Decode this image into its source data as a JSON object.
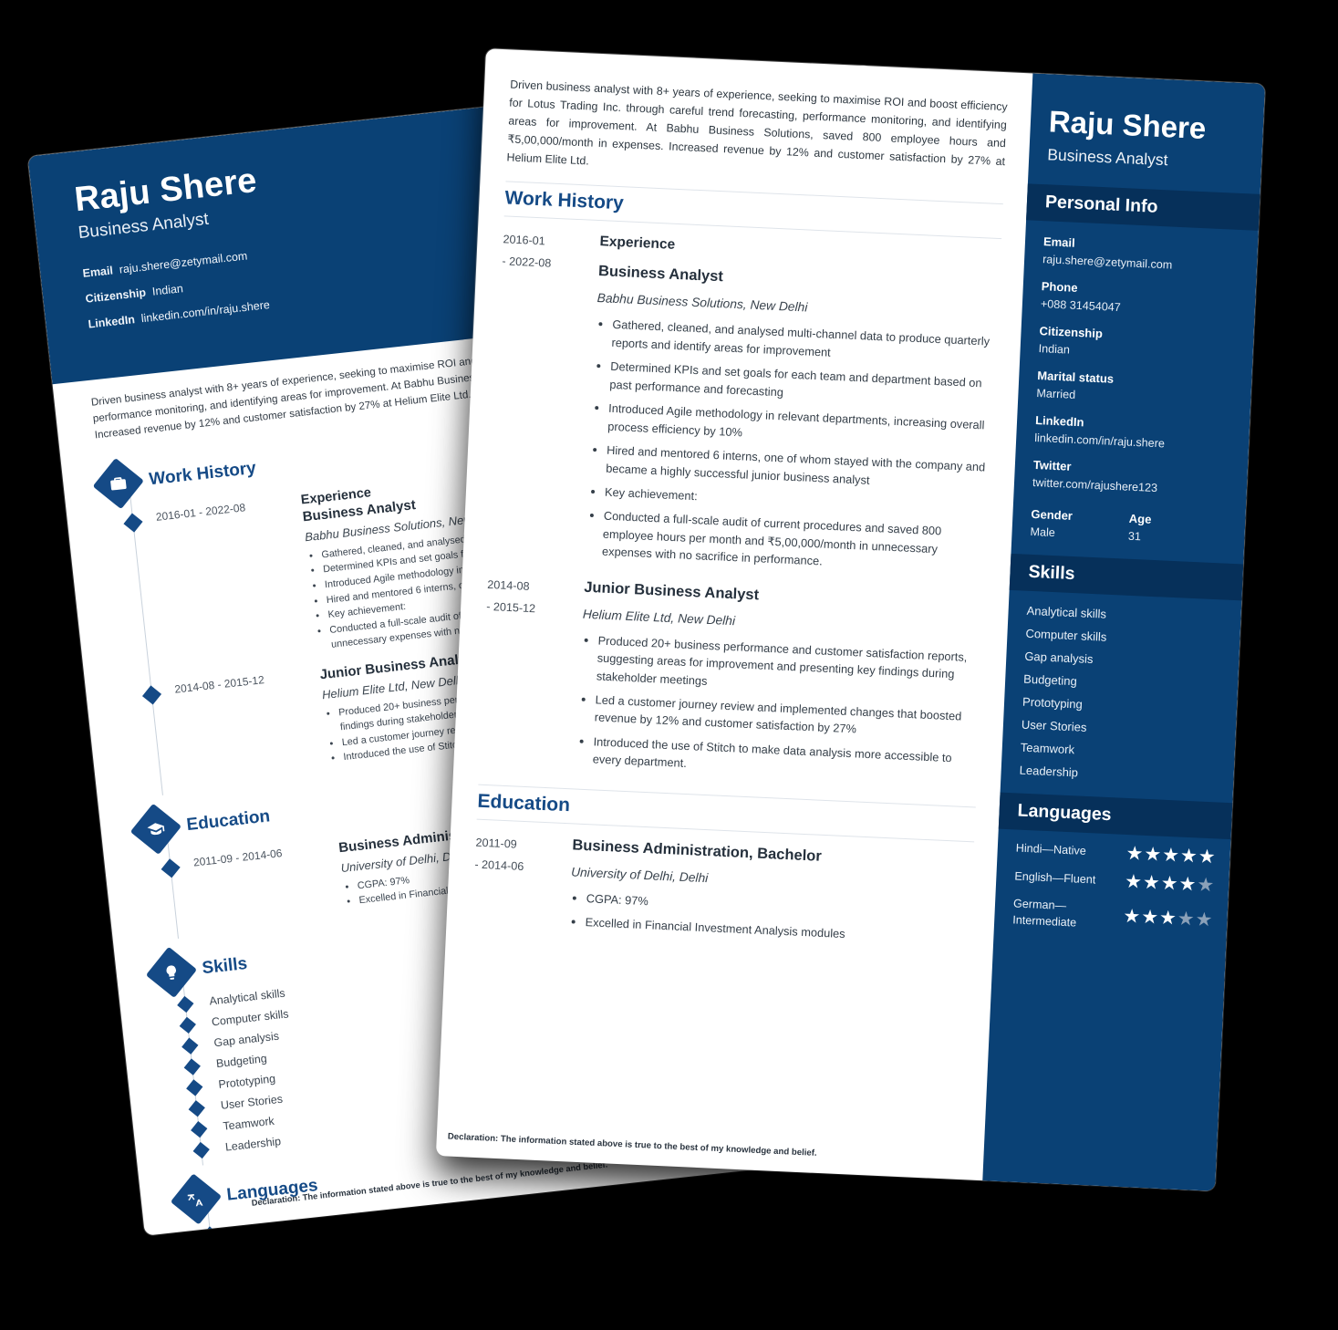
{
  "person": {
    "name": "Raju Shere",
    "title": "Business Analyst"
  },
  "summary": "Driven business analyst with 8+ years of experience, seeking to maximise ROI and boost efficiency for Lotus Trading Inc. through careful trend forecasting, performance monitoring, and identifying areas for improvement. At Babhu Business Solutions, saved 800 employee hours and ₹5,00,000/month in expenses. Increased revenue by 12% and customer satisfaction by 27% at Helium Elite Ltd.",
  "contacts": {
    "email_label": "Email",
    "email_value": "raju.shere@zetymail.com",
    "phone_label": "Phone",
    "phone_value": "+088 31454047",
    "citizenship_label": "Citizenship",
    "citizenship_value": "Indian",
    "marital_label": "Marital status",
    "marital_value": "Married",
    "linkedin_label": "LinkedIn",
    "linkedin_value": "linkedin.com/in/raju.shere",
    "twitter_label": "Twitter",
    "twitter_value": "twitter.com/rajushere123",
    "twitter_value_clipped": "twitter.com/rajushere12",
    "gender_label": "Gender",
    "gender_value": "Male",
    "age_label": "Age",
    "age_value": "31"
  },
  "sections": {
    "personal_info": "Personal Info",
    "work_history": "Work History",
    "education": "Education",
    "skills": "Skills",
    "languages": "Languages"
  },
  "work": [
    {
      "date_from": "2016-01",
      "date_to": "- 2022-08",
      "date_inline": "2016-01  - 2022-08",
      "kicker": "Experience",
      "role": "Business Analyst",
      "org": "Babhu Business Solutions, New Delhi",
      "bullets": [
        "Gathered, cleaned, and analysed multi-channel data to produce quarterly reports and identify areas for improvement",
        "Determined KPIs and set goals for each team and department based on past performance and forecasting",
        "Introduced Agile methodology in relevant departments, increasing overall process efficiency by 10%",
        "Hired and mentored 6 interns, one of whom stayed with the company and became a highly successful junior business analyst",
        "Key achievement:",
        "Conducted a full-scale audit of current procedures and saved 800 employee hours per month and ₹5,00,000/month in unnecessary expenses with no sacrifice in performance."
      ]
    },
    {
      "date_from": "2014-08",
      "date_to": "- 2015-12",
      "date_inline": "2014-08  - 2015-12",
      "kicker": "",
      "role": "Junior Business Analyst",
      "org": "Helium Elite Ltd, New Delhi",
      "bullets": [
        "Produced 20+ business performance and customer satisfaction reports, suggesting areas for improvement and presenting key findings during stakeholder meetings",
        "Led a customer journey review and implemented changes that boosted revenue by 12% and customer satisfaction by 27%",
        "Introduced the use of Stitch to make data analysis more accessible to every department."
      ]
    }
  ],
  "education": [
    {
      "date_from": "2011-09",
      "date_to": "- 2014-06",
      "date_inline": "2011-09  - 2014-06",
      "degree": "Business Administration, Bachelor",
      "school": "University of Delhi, Delhi",
      "bullets": [
        "CGPA: 97%",
        "Excelled in Financial Investment Analysis modules"
      ]
    }
  ],
  "skills": [
    "Analytical skills",
    "Computer skills",
    "Gap analysis",
    "Budgeting",
    "Prototyping",
    "User Stories",
    "Teamwork",
    "Leadership"
  ],
  "languages": [
    {
      "label": "Hindi—Native",
      "rating": 5,
      "max": 5
    },
    {
      "label": "English—Fluent",
      "rating": 4,
      "max": 5
    },
    {
      "label": "German—Intermediate",
      "rating": 3,
      "max": 5
    }
  ],
  "declaration": "Declaration: The information stated above is true to the best of my knowledge and belief.",
  "colors": {
    "brand_blue": "#0a4175",
    "band_blue": "#06305a",
    "icon_blue": "#154a86",
    "star_on": "#ffffff",
    "star_off": "#8aa0b8",
    "background": "#000000"
  }
}
